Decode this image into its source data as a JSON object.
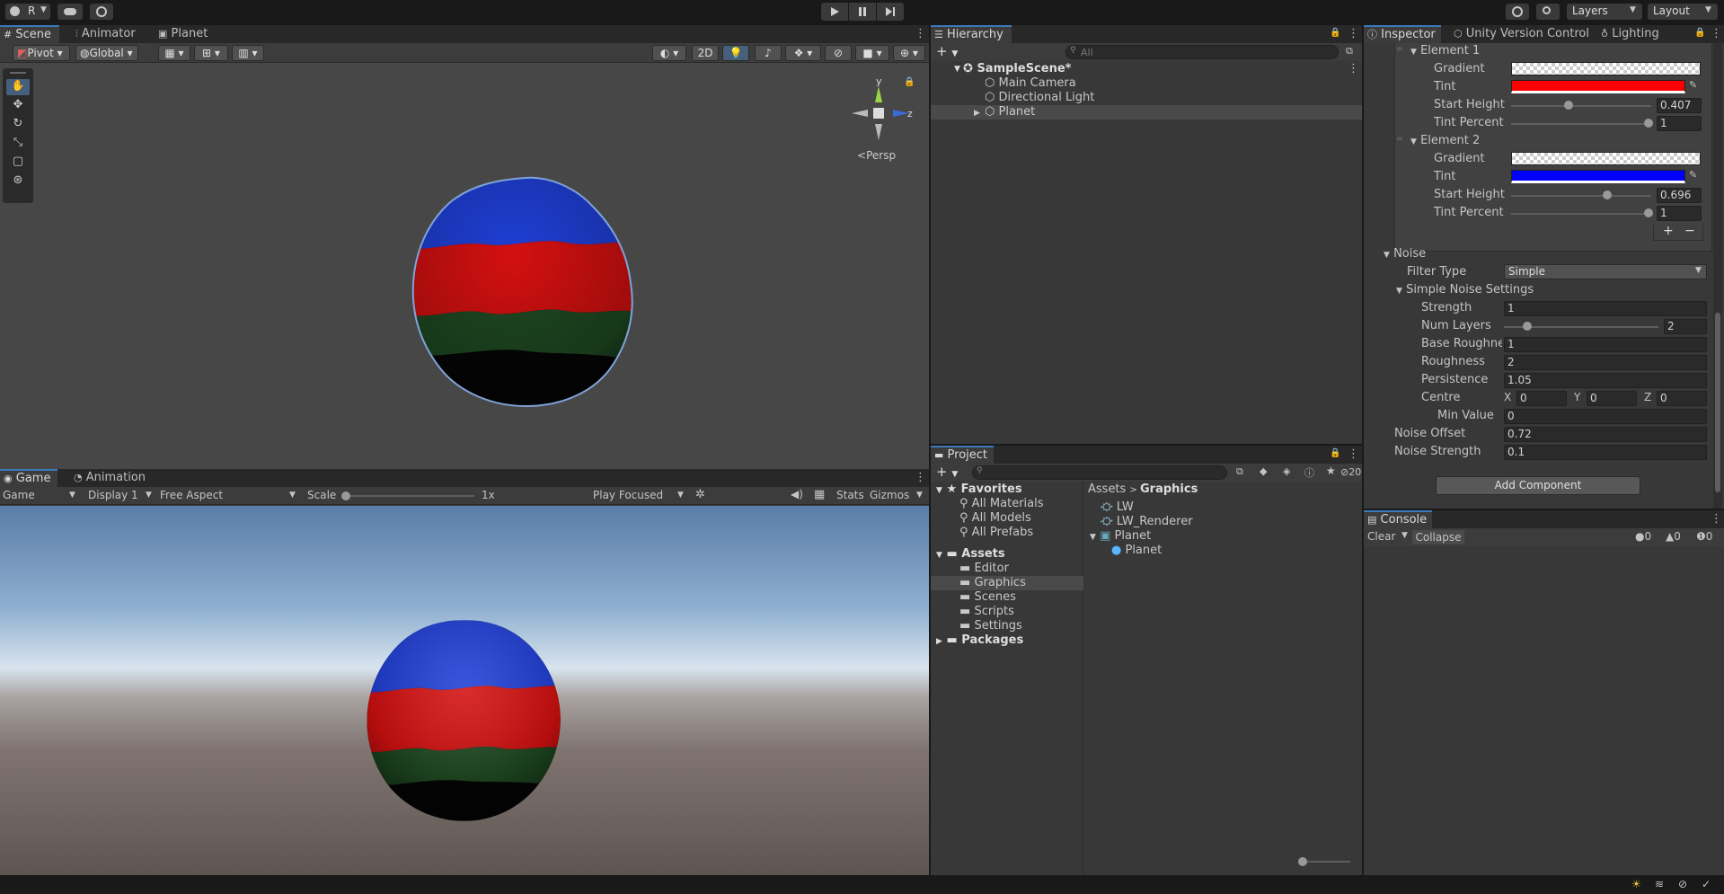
{
  "topbar": {
    "account": "R",
    "layers": "Layers",
    "layout": "Layout"
  },
  "scene": {
    "tabs": [
      "Scene",
      "Animator",
      "Planet"
    ],
    "pivot": "Pivot",
    "global": "Global",
    "btn_2d": "2D",
    "persp": "Persp",
    "gizmo_y": "y",
    "gizmo_z": "z"
  },
  "game": {
    "tabs": [
      "Game",
      "Animation"
    ],
    "mode": "Game",
    "display": "Display 1",
    "aspect": "Free Aspect",
    "scale_label": "Scale",
    "scale_value": "1x",
    "play_focused": "Play Focused",
    "stats": "Stats",
    "gizmos": "Gizmos"
  },
  "hierarchy": {
    "tab": "Hierarchy",
    "search_placeholder": "All",
    "scene": "SampleScene*",
    "items": [
      "Main Camera",
      "Directional Light",
      "Planet"
    ]
  },
  "project": {
    "tab": "Project",
    "hidden_count": "20",
    "favorites": "Favorites",
    "fav_items": [
      "All Materials",
      "All Models",
      "All Prefabs"
    ],
    "assets": "Assets",
    "asset_folders": [
      "Editor",
      "Graphics",
      "Scenes",
      "Scripts",
      "Settings"
    ],
    "packages": "Packages",
    "breadcrumb": [
      "Assets",
      "Graphics"
    ],
    "files": [
      "LW",
      "LW_Renderer",
      "Planet",
      "Planet"
    ]
  },
  "inspector": {
    "tabs": [
      "Inspector",
      "Unity Version Control",
      "Lighting"
    ],
    "element1": {
      "title": "Element 1",
      "gradient_label": "Gradient",
      "tint_label": "Tint",
      "tint_color": "#ff0000",
      "start_height_label": "Start Height",
      "start_height": "0.407",
      "tint_percent_label": "Tint Percent",
      "tint_percent": "1"
    },
    "element2": {
      "title": "Element 2",
      "gradient_label": "Gradient",
      "tint_label": "Tint",
      "tint_color": "#0000ff",
      "start_height_label": "Start Height",
      "start_height": "0.696",
      "tint_percent_label": "Tint Percent",
      "tint_percent": "1"
    },
    "noise": {
      "title": "Noise",
      "filter_type_label": "Filter Type",
      "filter_type": "Simple",
      "simple_settings": "Simple Noise Settings",
      "strength_label": "Strength",
      "strength": "1",
      "num_layers_label": "Num Layers",
      "num_layers": "2",
      "base_roughness_label": "Base Roughness",
      "base_roughness": "1",
      "roughness_label": "Roughness",
      "roughness": "2",
      "persistence_label": "Persistence",
      "persistence": "1.05",
      "centre_label": "Centre",
      "cx_label": "X",
      "cx": "0",
      "cy_label": "Y",
      "cy": "0",
      "cz_label": "Z",
      "cz": "0",
      "min_value_label": "Min Value",
      "min_value": "0",
      "noise_offset_label": "Noise Offset",
      "noise_offset": "0.72",
      "noise_strength_label": "Noise Strength",
      "noise_strength": "0.1"
    },
    "add_component": "Add Component"
  },
  "console": {
    "tab": "Console",
    "clear": "Clear",
    "collapse": "Collapse",
    "info_count": "0",
    "warn_count": "0",
    "error_count": "0"
  },
  "colors": {
    "accent": "#3a79bb",
    "planet_blue": "#1f3fd6",
    "planet_red": "#d41010",
    "planet_green": "#1f4a22"
  }
}
